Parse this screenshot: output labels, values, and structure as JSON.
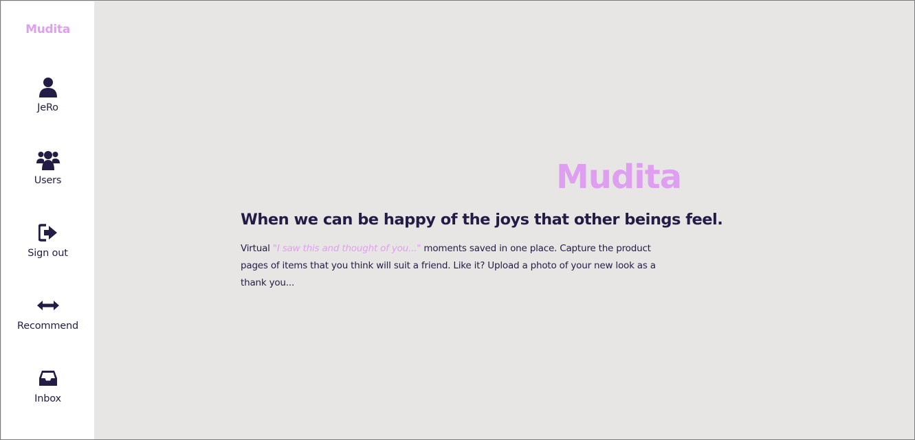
{
  "sidebar": {
    "brand": "Mudita",
    "items": [
      {
        "label": "JeRo",
        "icon": "user-icon"
      },
      {
        "label": "Users",
        "icon": "users-icon"
      },
      {
        "label": "Sign out",
        "icon": "sign-out-icon"
      },
      {
        "label": "Recommend",
        "icon": "arrows-horizontal-icon"
      },
      {
        "label": "Inbox",
        "icon": "inbox-icon"
      }
    ]
  },
  "main": {
    "title": "Mudita",
    "tagline": "When we can be happy of the joys that other beings feel.",
    "description": {
      "prefix": "Virtual ",
      "quote": "\"I saw this and thought of you...\"",
      "suffix": " moments saved in one place. Capture the product pages of items that you think will suit a friend. Like it? Upload a photo of your new look as a thank you..."
    }
  },
  "colors": {
    "accent": "#df9ff0",
    "text": "#231c44",
    "background": "#e8e6e5",
    "sidebar": "#ffffff"
  }
}
